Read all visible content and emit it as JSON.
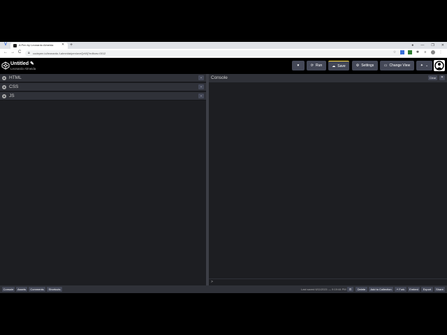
{
  "browser": {
    "tab_title": "A Pen by Leonardo Almeida",
    "url": "codepen.io/leonardo-f-almeida/pen/wvrQxWj?editors=0012",
    "nav": [
      "←",
      "→",
      "C"
    ],
    "new_tab": "+",
    "window_controls": [
      "●",
      "—",
      "❐",
      "✕"
    ]
  },
  "header": {
    "title": "Untitled",
    "edit_icon": "✎",
    "author": "Leonardo Almeida",
    "like_icon": "♥",
    "run_label": "Run",
    "save_label": "Save",
    "settings_label": "Settings",
    "change_view_label": "Change View",
    "pin_icon": "✦",
    "chevron": "⌄"
  },
  "editors": [
    {
      "name": "HTML"
    },
    {
      "name": "CSS"
    },
    {
      "name": "JS"
    }
  ],
  "editor_collapse_glyph": "⌄",
  "console": {
    "title": "Console",
    "clear_label": "Clear",
    "close_glyph": "✕",
    "prompt": ">"
  },
  "footer": {
    "console_label": "Console",
    "assets_label": "Assets",
    "comments_label": "Comments",
    "shortcuts_label": "Shortcuts",
    "last_saved": "Last saved 6/11/2021 — 9:19:44 PM",
    "delete_label": "Delete",
    "add_collection_label": "Add to Collection",
    "fork_label": "⑂ Fork",
    "embed_label": "Embed",
    "export_label": "Export",
    "share_label": "Share"
  },
  "colors": {
    "background": "#1d1e22",
    "panel": "#2f3138",
    "button": "#444857",
    "save_accent": "#ffdd40"
  }
}
